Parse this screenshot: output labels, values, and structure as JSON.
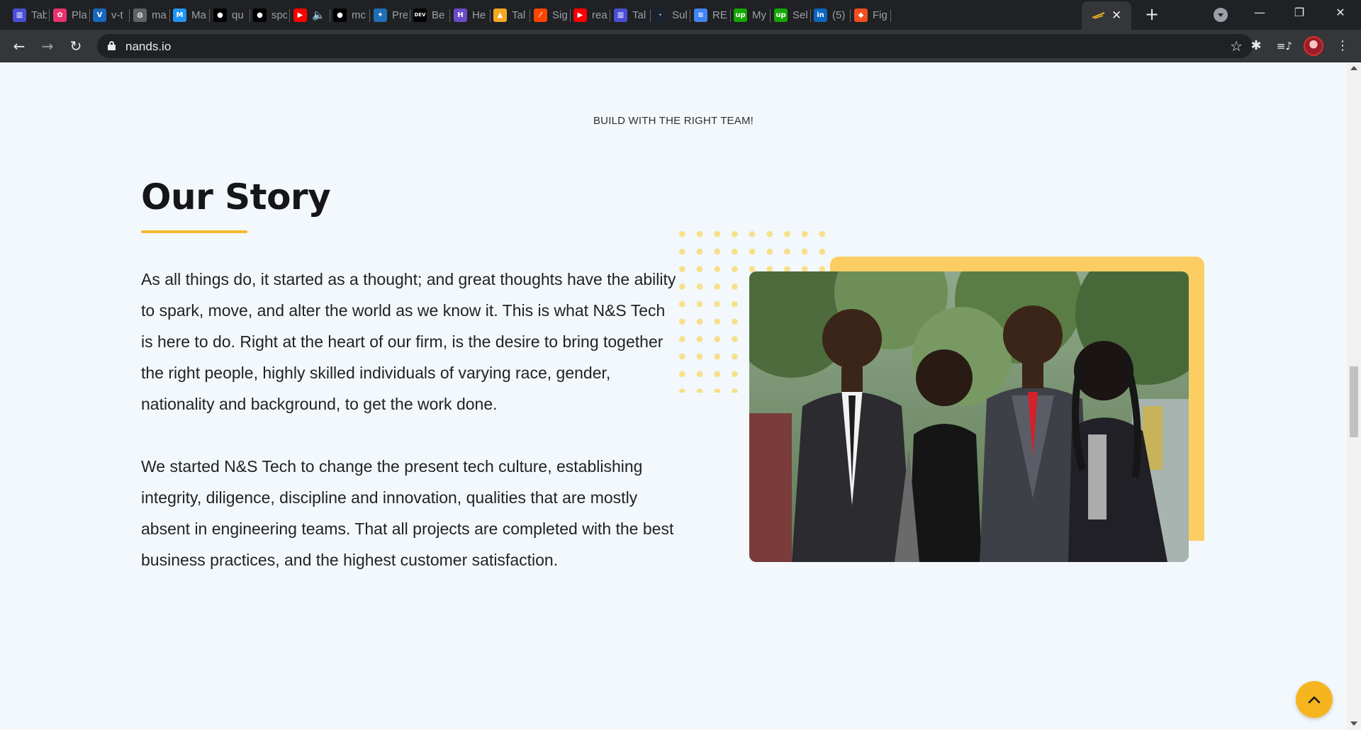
{
  "browser": {
    "tabs": [
      {
        "title": "Tab",
        "icon": "bars-chart-icon",
        "color": "#4b4fd6",
        "glyph": "▥"
      },
      {
        "title": "Pla",
        "icon": "gear-pink-icon",
        "color": "#e8336d",
        "glyph": "✿"
      },
      {
        "title": "v-t",
        "icon": "vuetify-v-icon",
        "color": "#1867c0",
        "glyph": "V"
      },
      {
        "title": "ma",
        "icon": "globe-icon",
        "color": "#5f6368",
        "glyph": "◍"
      },
      {
        "title": "Ma",
        "icon": "m-logo-icon",
        "color": "#2196f3",
        "glyph": "M"
      },
      {
        "title": "qu",
        "icon": "github-icon",
        "color": "#000000",
        "glyph": "●"
      },
      {
        "title": "spc",
        "icon": "github-icon",
        "color": "#000000",
        "glyph": "●"
      },
      {
        "title": "",
        "icon": "youtube-icon",
        "color": "#ff0000",
        "glyph": "▶",
        "audio": "🔈"
      },
      {
        "title": "mc",
        "icon": "github-icon",
        "color": "#000000",
        "glyph": "●"
      },
      {
        "title": "Pre",
        "icon": "star-app-icon",
        "color": "#1f6fb5",
        "glyph": "✦"
      },
      {
        "title": "Be",
        "icon": "dev-logo-icon",
        "color": "#000000",
        "glyph": "DEV"
      },
      {
        "title": "He",
        "icon": "h-logo-icon",
        "color": "#6c4bc9",
        "glyph": "H"
      },
      {
        "title": "Tal",
        "icon": "fire-icon",
        "color": "#f6a821",
        "glyph": "▲"
      },
      {
        "title": "Sig",
        "icon": "slash-logo-icon",
        "color": "#ff4500",
        "glyph": "⁄"
      },
      {
        "title": "rea",
        "icon": "youtube-icon",
        "color": "#ff0000",
        "glyph": "▶"
      },
      {
        "title": "Tal",
        "icon": "bars-chart-icon",
        "color": "#4b4fd6",
        "glyph": "▥"
      },
      {
        "title": "Sul",
        "icon": "dark-app-icon",
        "color": "#1a2230",
        "glyph": "·"
      },
      {
        "title": "RE",
        "icon": "docs-icon",
        "color": "#4285f4",
        "glyph": "≡"
      },
      {
        "title": "My",
        "icon": "upwork-icon",
        "color": "#14a800",
        "glyph": "up"
      },
      {
        "title": "Sel",
        "icon": "upwork-icon",
        "color": "#14a800",
        "glyph": "up"
      },
      {
        "title": "(5)",
        "icon": "linkedin-icon",
        "color": "#0a66c2",
        "glyph": "in"
      },
      {
        "title": "Fig",
        "icon": "figma-icon",
        "color": "#f24e1e",
        "glyph": "◆"
      }
    ],
    "active_tab_close": "✕",
    "new_tab": "+",
    "window_min": "—",
    "window_max": "❐",
    "window_close": "✕",
    "back": "←",
    "forward": "→",
    "reload": "↻",
    "url": "nands.io",
    "bookmark_star": "☆",
    "extensions_icon": "✱",
    "media_icon": "≡♪",
    "menu_icon": "⋮"
  },
  "page": {
    "eyebrow": "BUILD WITH THE RIGHT TEAM!",
    "title": "Our Story",
    "paragraph_1": "As all things do, it started as a thought; and great thoughts have the ability to spark, move, and alter the world as we know it. This is what N&S Tech is here to do. Right at the heart of our firm, is the desire to bring together the right people, highly skilled individuals of varying race, gender, nationality and background, to get the work done.",
    "paragraph_2": "We started N&S Tech to change the present tech culture, establishing integrity, diligence, discipline and innovation, qualities that are mostly absent in engineering teams. That all projects are completed with the best business practices, and the highest customer satisfaction.",
    "accent_color": "#f5b82e",
    "photo_backdrop_color": "#fccd62",
    "dots_color": "#f6e08a",
    "back_to_top_color": "#f6b51f"
  }
}
